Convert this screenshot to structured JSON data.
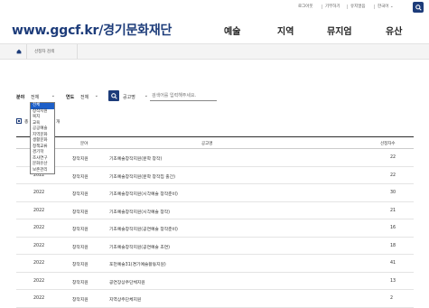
{
  "util": {
    "logout": "로그아웃",
    "donate": "기부하기",
    "account": "유지얼음",
    "lang": "한국어"
  },
  "logo_text": "www.ggcf.kr/경기문화재단",
  "nav": [
    "예술",
    "지역",
    "뮤지엄",
    "유산"
  ],
  "breadcrumb": "선정자 검색",
  "filters": {
    "field_label": "분야",
    "field_value": "전체",
    "year_label": "연도",
    "year_value": "전체",
    "search_field_value": "공고명",
    "keyword_placeholder": "검색어를 입력해주세요."
  },
  "dropdown_options": [
    "전체",
    "창작지원",
    "복지",
    "교육",
    "공공예술",
    "지역문화",
    "생활문화",
    "정책교류",
    "경기학",
    "조사연구",
    "문화유산",
    "보존관리"
  ],
  "dropdown_selected": "전체",
  "result_label_visible": "총",
  "result_label_tail": "개",
  "table": {
    "headers": [
      "연도",
      "분야",
      "공고명",
      "선정자수"
    ],
    "rows": [
      {
        "year": "2022",
        "field": "창작지원",
        "title": "기초예술창작지원(문학 창작)",
        "count": "22"
      },
      {
        "year": "2022",
        "field": "창작지원",
        "title": "기초예술창작지원(문학 창작집 출간)",
        "count": "22"
      },
      {
        "year": "2022",
        "field": "창작지원",
        "title": "기초예술창작지원(시각예술 창작준비)",
        "count": "30"
      },
      {
        "year": "2022",
        "field": "창작지원",
        "title": "기초예술창작지원(시각예술 창작)",
        "count": "21"
      },
      {
        "year": "2022",
        "field": "창작지원",
        "title": "기초예술창작지원(공연예술 창작준비)",
        "count": "16"
      },
      {
        "year": "2022",
        "field": "창작지원",
        "title": "기초예술창작지원(공연예술 초연)",
        "count": "18"
      },
      {
        "year": "2022",
        "field": "창작지원",
        "title": "포천예술31(경기예술활동지원)",
        "count": "41"
      },
      {
        "year": "2022",
        "field": "창작지원",
        "title": "공연장상주단체지원",
        "count": "13"
      },
      {
        "year": "2022",
        "field": "창작지원",
        "title": "지역상주단체지원",
        "count": "2"
      }
    ]
  }
}
